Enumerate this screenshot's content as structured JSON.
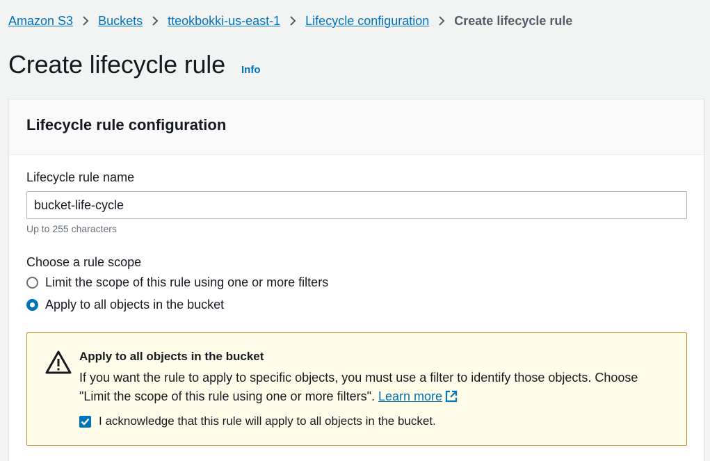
{
  "breadcrumbs": {
    "items": [
      "Amazon S3",
      "Buckets",
      "tteokbokki-us-east-1",
      "Lifecycle configuration"
    ],
    "current": "Create lifecycle rule"
  },
  "page": {
    "title": "Create lifecycle rule",
    "info_label": "Info"
  },
  "panel": {
    "title": "Lifecycle rule configuration",
    "rule_name": {
      "label": "Lifecycle rule name",
      "value": "bucket-life-cycle",
      "hint": "Up to 255 characters"
    },
    "scope": {
      "label": "Choose a rule scope",
      "options": [
        {
          "label": "Limit the scope of this rule using one or more filters",
          "selected": false
        },
        {
          "label": "Apply to all objects in the bucket",
          "selected": true
        }
      ]
    },
    "alert": {
      "icon": "warning-icon",
      "title": "Apply to all objects in the bucket",
      "body": "If you want the rule to apply to specific objects, you must use a filter to identify those objects. Choose \"Limit the scope of this rule using one or more filters\".",
      "link_label": "Learn more",
      "acknowledge_label": "I acknowledge that this rule will apply to all objects in the bucket.",
      "acknowledged": true
    }
  },
  "colors": {
    "link": "#0073bb",
    "warning_border": "#b9902b",
    "warning_bg": "#fffce9"
  }
}
